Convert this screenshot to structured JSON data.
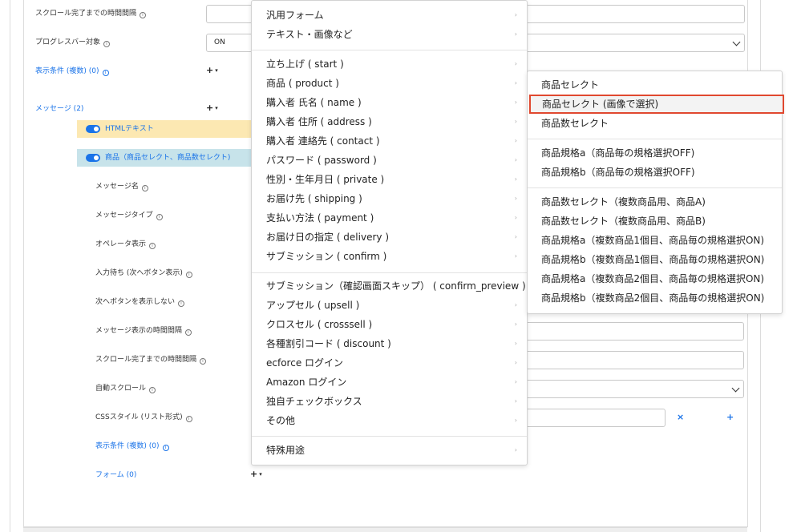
{
  "form": {
    "top_labels": {
      "scroll_interval": "スクロール完了までの時間間隔",
      "progress_target": "プログレスバー対象",
      "display_cond": "表示条件 (複数) (0)",
      "message": "メッセージ (2)"
    },
    "progress_value": "ON",
    "plus": "+",
    "caret": "▾",
    "info": "i",
    "bands": {
      "html_text": "HTMLテキスト",
      "product": "商品（商品セレクト、商品数セレクト)"
    },
    "sub_labels": {
      "message_name": "メッセージ名",
      "message_type": "メッセージタイプ",
      "operator": "オペレータ表示",
      "input_wait": "入力待ち (次へボタン表示)",
      "hide_next": "次へボタンを表示しない",
      "display_interval": "メッセージ表示の時間間隔",
      "scroll_interval": "スクロール完了までの時間間隔",
      "auto_scroll": "自動スクロール",
      "css_style": "CSSスタイル (リスト形式)",
      "display_cond": "表示条件 (複数) (0)",
      "form": "フォーム (0)"
    },
    "remove": "×",
    "add": "+"
  },
  "menu": {
    "arrow": "›",
    "group1": [
      "汎用フォーム",
      "テキスト・画像など"
    ],
    "group2": [
      "立ち上げ ( start )",
      "商品 ( product )",
      "購入者 氏名 ( name )",
      "購入者 住所 ( address )",
      "購入者 連絡先 ( contact )",
      "パスワード ( password )",
      "性別・生年月日 ( private )",
      "お届け先 ( shipping )",
      "支払い方法 ( payment )",
      "お届け日の指定 ( delivery )",
      "サブミッション ( confirm )"
    ],
    "group3": [
      "サブミッション（確認画面スキップ） ( confirm_preview )",
      "アップセル ( upsell )",
      "クロスセル ( crosssell )",
      "各種割引コード ( discount )",
      "ecforce ログイン",
      "Amazon ログイン",
      "独自チェックボックス",
      "その他"
    ],
    "group4": [
      "特殊用途"
    ]
  },
  "submenu": {
    "group1": [
      "商品セレクト",
      "商品セレクト (画像で選択)",
      "商品数セレクト"
    ],
    "group2": [
      "商品規格a（商品毎の規格選択OFF)",
      "商品規格b（商品毎の規格選択OFF)"
    ],
    "group3": [
      "商品数セレクト（複数商品用、商品A)",
      "商品数セレクト（複数商品用、商品B)",
      "商品規格a（複数商品1個目、商品毎の規格選択ON)",
      "商品規格b（複数商品1個目、商品毎の規格選択ON)",
      "商品規格a（複数商品2個目、商品毎の規格選択ON)",
      "商品規格b（複数商品2個目、商品毎の規格選択ON)"
    ]
  },
  "colors": {
    "accent": "#1a73e8",
    "highlight_border": "#e0482f",
    "band_yellow": "#fce8b2",
    "band_cyan": "#c7e3ea"
  }
}
